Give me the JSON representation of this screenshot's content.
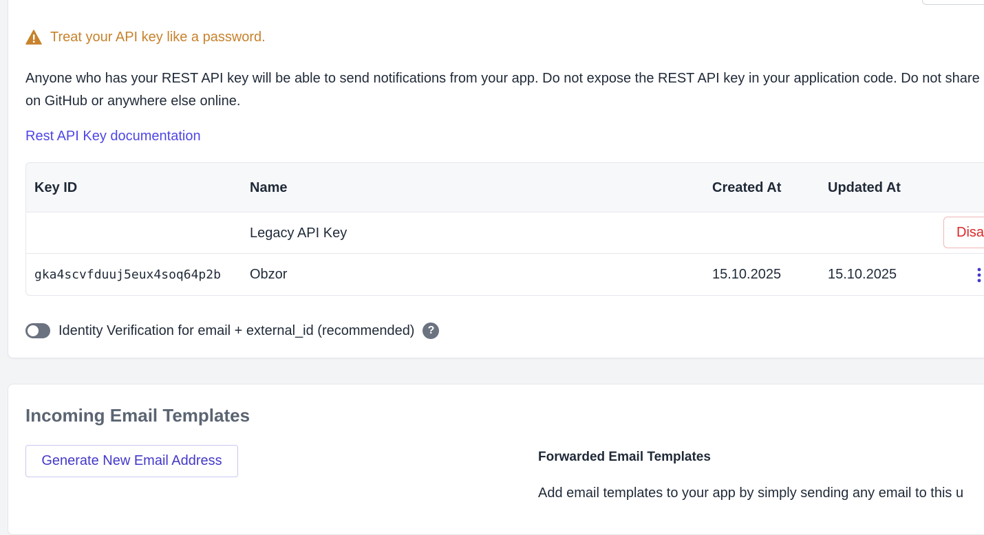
{
  "api_keys": {
    "warning": "Treat your API key like a password.",
    "description": "Anyone who has your REST API key will be able to send notifications from your app. Do not expose the REST API key in your application code. Do not share it on GitHub or anywhere else online.",
    "doc_link": "Rest API Key documentation",
    "table": {
      "headers": [
        "Key ID",
        "Name",
        "Created At",
        "Updated At"
      ],
      "rows": [
        {
          "key_id": "",
          "name": "Legacy API Key",
          "created_at": "",
          "updated_at": "",
          "action": "Disable"
        },
        {
          "key_id": "gka4scvfduuj5eux4soq64p2b",
          "name": "Obzor",
          "created_at": "15.10.2025",
          "updated_at": "15.10.2025",
          "action_icon": "kebab-menu-icon"
        }
      ]
    },
    "identity_verification": {
      "label": "Identity Verification for email + external_id (recommended)",
      "enabled": false,
      "help": "?"
    }
  },
  "email_templates": {
    "title": "Incoming Email Templates",
    "generate_button": "Generate New Email Address",
    "forwarded_title": "Forwarded Email Templates",
    "forwarded_desc": "Add email templates to your app by simply sending any email to this u"
  },
  "colors": {
    "warning": "#c7822c",
    "link": "#4f46e5",
    "danger": "#dc2626",
    "toggle_off": "#6b7280"
  }
}
